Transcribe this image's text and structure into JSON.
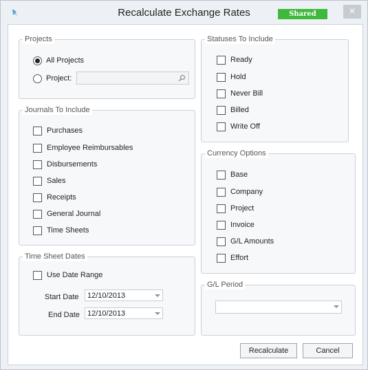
{
  "window": {
    "title": "Recalculate Exchange Rates",
    "shared_badge": "Shared",
    "close_glyph": "×",
    "badge_color": "#3fb93b"
  },
  "projects": {
    "legend": "Projects",
    "all_projects_label": "All Projects",
    "project_label": "Project:",
    "selected": "All Projects",
    "project_value": ""
  },
  "journals": {
    "legend": "Journals To Include",
    "items": [
      {
        "label": "Purchases",
        "checked": false
      },
      {
        "label": "Employee Reimbursables",
        "checked": false
      },
      {
        "label": "Disbursements",
        "checked": false
      },
      {
        "label": "Sales",
        "checked": false
      },
      {
        "label": "Receipts",
        "checked": false
      },
      {
        "label": "General Journal",
        "checked": false
      },
      {
        "label": "Time Sheets",
        "checked": false
      }
    ]
  },
  "time_sheet_dates": {
    "legend": "Time Sheet Dates",
    "use_date_range_label": "Use Date Range",
    "use_date_range_checked": false,
    "start_label": "Start Date",
    "start_value": "12/10/2013",
    "end_label": "End Date",
    "end_value": "12/10/2013"
  },
  "statuses": {
    "legend": "Statuses To Include",
    "items": [
      {
        "label": "Ready",
        "checked": false
      },
      {
        "label": "Hold",
        "checked": false
      },
      {
        "label": "Never Bill",
        "checked": false
      },
      {
        "label": "Billed",
        "checked": false
      },
      {
        "label": "Write Off",
        "checked": false
      }
    ]
  },
  "currency": {
    "legend": "Currency Options",
    "items": [
      {
        "label": "Base",
        "checked": false
      },
      {
        "label": "Company",
        "checked": false
      },
      {
        "label": "Project",
        "checked": false
      },
      {
        "label": "Invoice",
        "checked": false
      },
      {
        "label": "G/L Amounts",
        "checked": false
      },
      {
        "label": "Effort",
        "checked": false
      }
    ]
  },
  "gl_period": {
    "legend": "G/L Period",
    "value": ""
  },
  "buttons": {
    "recalculate": "Recalculate",
    "cancel": "Cancel"
  }
}
